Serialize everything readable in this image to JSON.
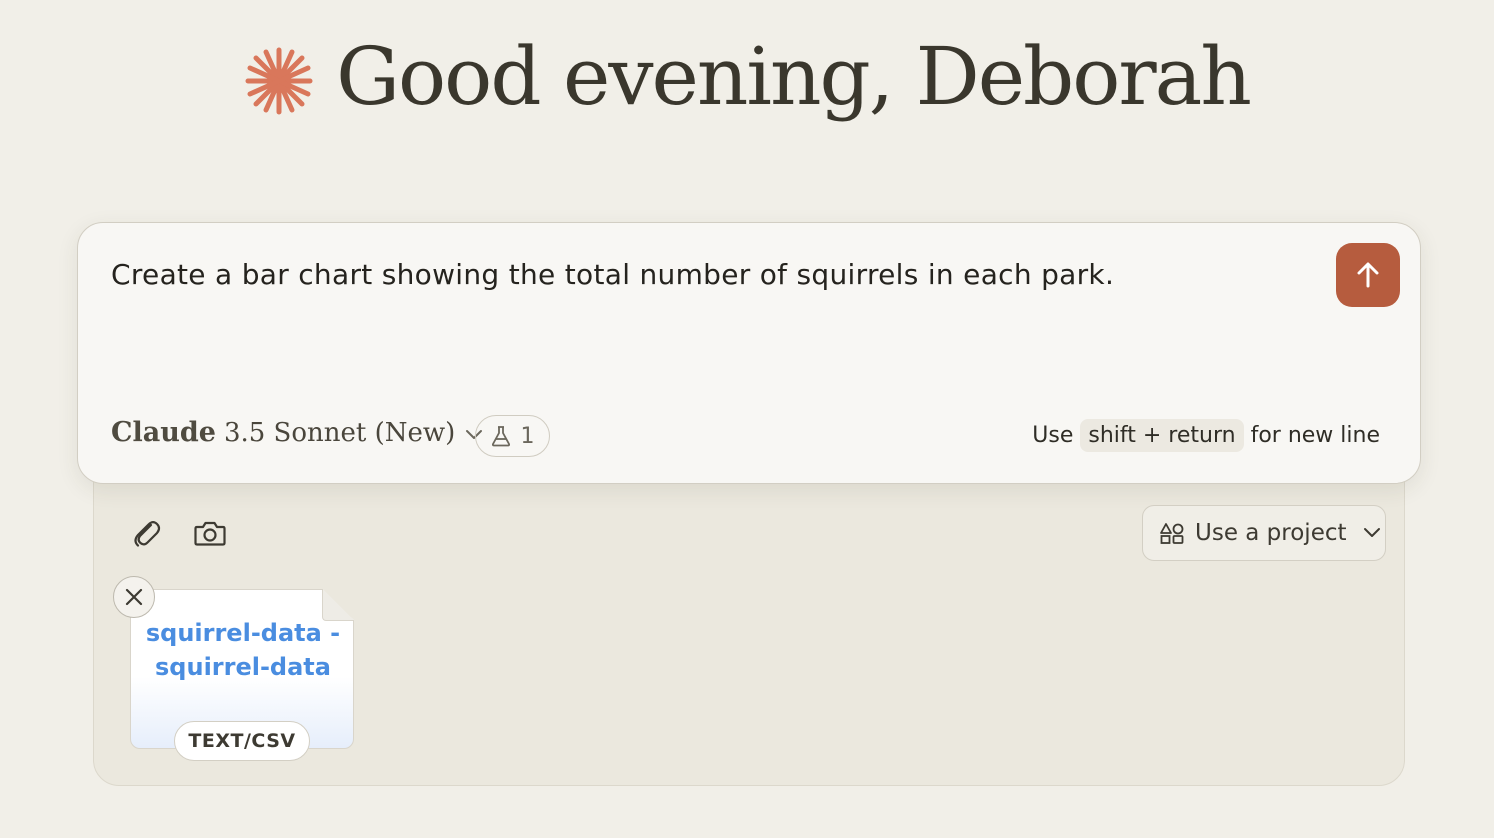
{
  "greeting": {
    "text": "Good evening, Deborah",
    "logo_icon": "claude-starburst-icon",
    "logo_color": "#d9775b"
  },
  "composer": {
    "prompt_value": "Create a bar chart showing the total number of squirrels in each park.",
    "send_icon": "arrow-up-icon",
    "send_color": "#b65c3e",
    "model": {
      "brand": "Claude",
      "version": "3.5 Sonnet (New)",
      "chevron_icon": "chevron-down-icon"
    },
    "feature_pill": {
      "icon": "flask-icon",
      "count": "1"
    },
    "hint": {
      "prefix": "Use",
      "keys": "shift + return",
      "suffix": "for new line"
    }
  },
  "tray": {
    "attach_icon": "paperclip-icon",
    "screenshot_icon": "camera-icon",
    "project_button": {
      "icon": "shapes-icon",
      "label": "Use a project",
      "chevron_icon": "chevron-down-icon"
    },
    "attachment": {
      "name": "squirrel-data - squirrel-data",
      "type": "TEXT/CSV",
      "remove_icon": "close-icon"
    }
  }
}
